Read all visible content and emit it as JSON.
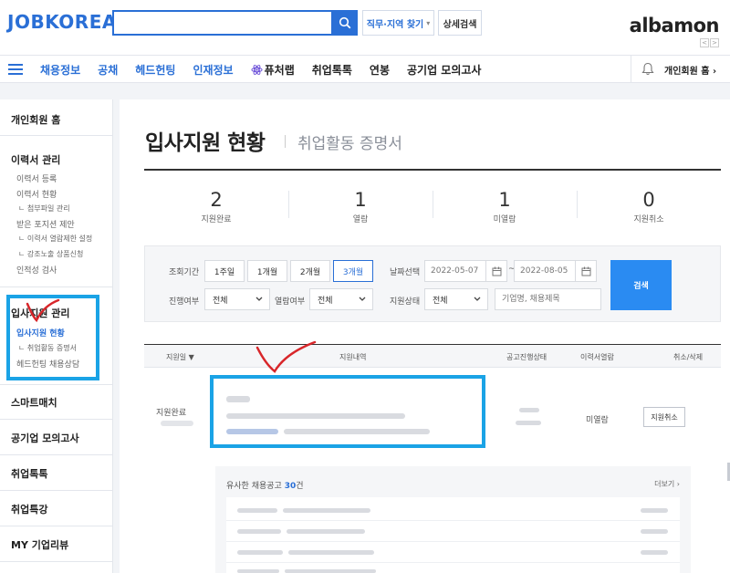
{
  "header": {
    "logo": "JOBKOREA",
    "search_placeholder": "",
    "job_area_label": "직무·지역 찾기",
    "detail_search_label": "상세검색",
    "partner_logo": "albamon",
    "partner_nav": [
      "<",
      ">"
    ]
  },
  "nav": {
    "items": [
      "채용정보",
      "공채",
      "헤드헌팅",
      "인재정보",
      "퓨처랩",
      "취업톡톡",
      "연봉",
      "공기업 모의고사"
    ],
    "user_menu": "개인회원 홈 ›"
  },
  "sidebar": {
    "home": "개인회원 홈",
    "resume_section": {
      "title": "이력서 관리",
      "items": [
        "이력서 등록",
        "이력서 현황",
        "ㄴ 첨부파일 관리",
        "받은 포지션 제안",
        "ㄴ 이력서 열람제한 설정",
        "ㄴ 강조노출 상품신청",
        "인적성 검사"
      ]
    },
    "apply_section": {
      "title": "입사지원 관리",
      "items": [
        "입사지원 현황",
        "ㄴ 취업활동 증명서",
        "헤드헌팅 채용상담"
      ]
    },
    "menus": [
      "스마트매치",
      "공기업 모의고사",
      "취업톡톡",
      "취업특강",
      "MY 기업리뷰"
    ]
  },
  "page": {
    "title": "입사지원 현황",
    "subtitle": "취업활동 증명서"
  },
  "stats": [
    {
      "value": "2",
      "label": "지원완료"
    },
    {
      "value": "1",
      "label": "열람"
    },
    {
      "value": "1",
      "label": "미열람"
    },
    {
      "value": "0",
      "label": "지원취소"
    }
  ],
  "filter": {
    "period_label": "조회기간",
    "periods": [
      "1주일",
      "1개월",
      "2개월",
      "3개월"
    ],
    "active_period": "3개월",
    "date_select_label": "날짜선택",
    "date_from": "2022-05-07",
    "date_separator": "~",
    "date_to": "2022-08-05",
    "progress_label": "진행여부",
    "progress_value": "전체",
    "read_label": "열람여부",
    "read_value": "전체",
    "status_label": "지원상태",
    "status_value": "전체",
    "keyword_placeholder": "기업명, 채용제목",
    "search_button": "검색"
  },
  "table": {
    "headers": [
      "지원일 ▼",
      "지원내역",
      "공고진행상태",
      "이력서열람",
      "취소/삭제"
    ],
    "rows": [
      {
        "status": "지원완료",
        "read_status": "미열람",
        "action": "지원취소"
      }
    ]
  },
  "similar": {
    "title_prefix": "유사한 채용공고",
    "count": "30",
    "count_suffix": "건",
    "more": "더보기 ›"
  },
  "colors": {
    "brand_blue": "#2a6fd6",
    "highlight_box": "#1aa3e6",
    "annotation_red": "#d8262a",
    "search_button": "#2a8bf2"
  }
}
